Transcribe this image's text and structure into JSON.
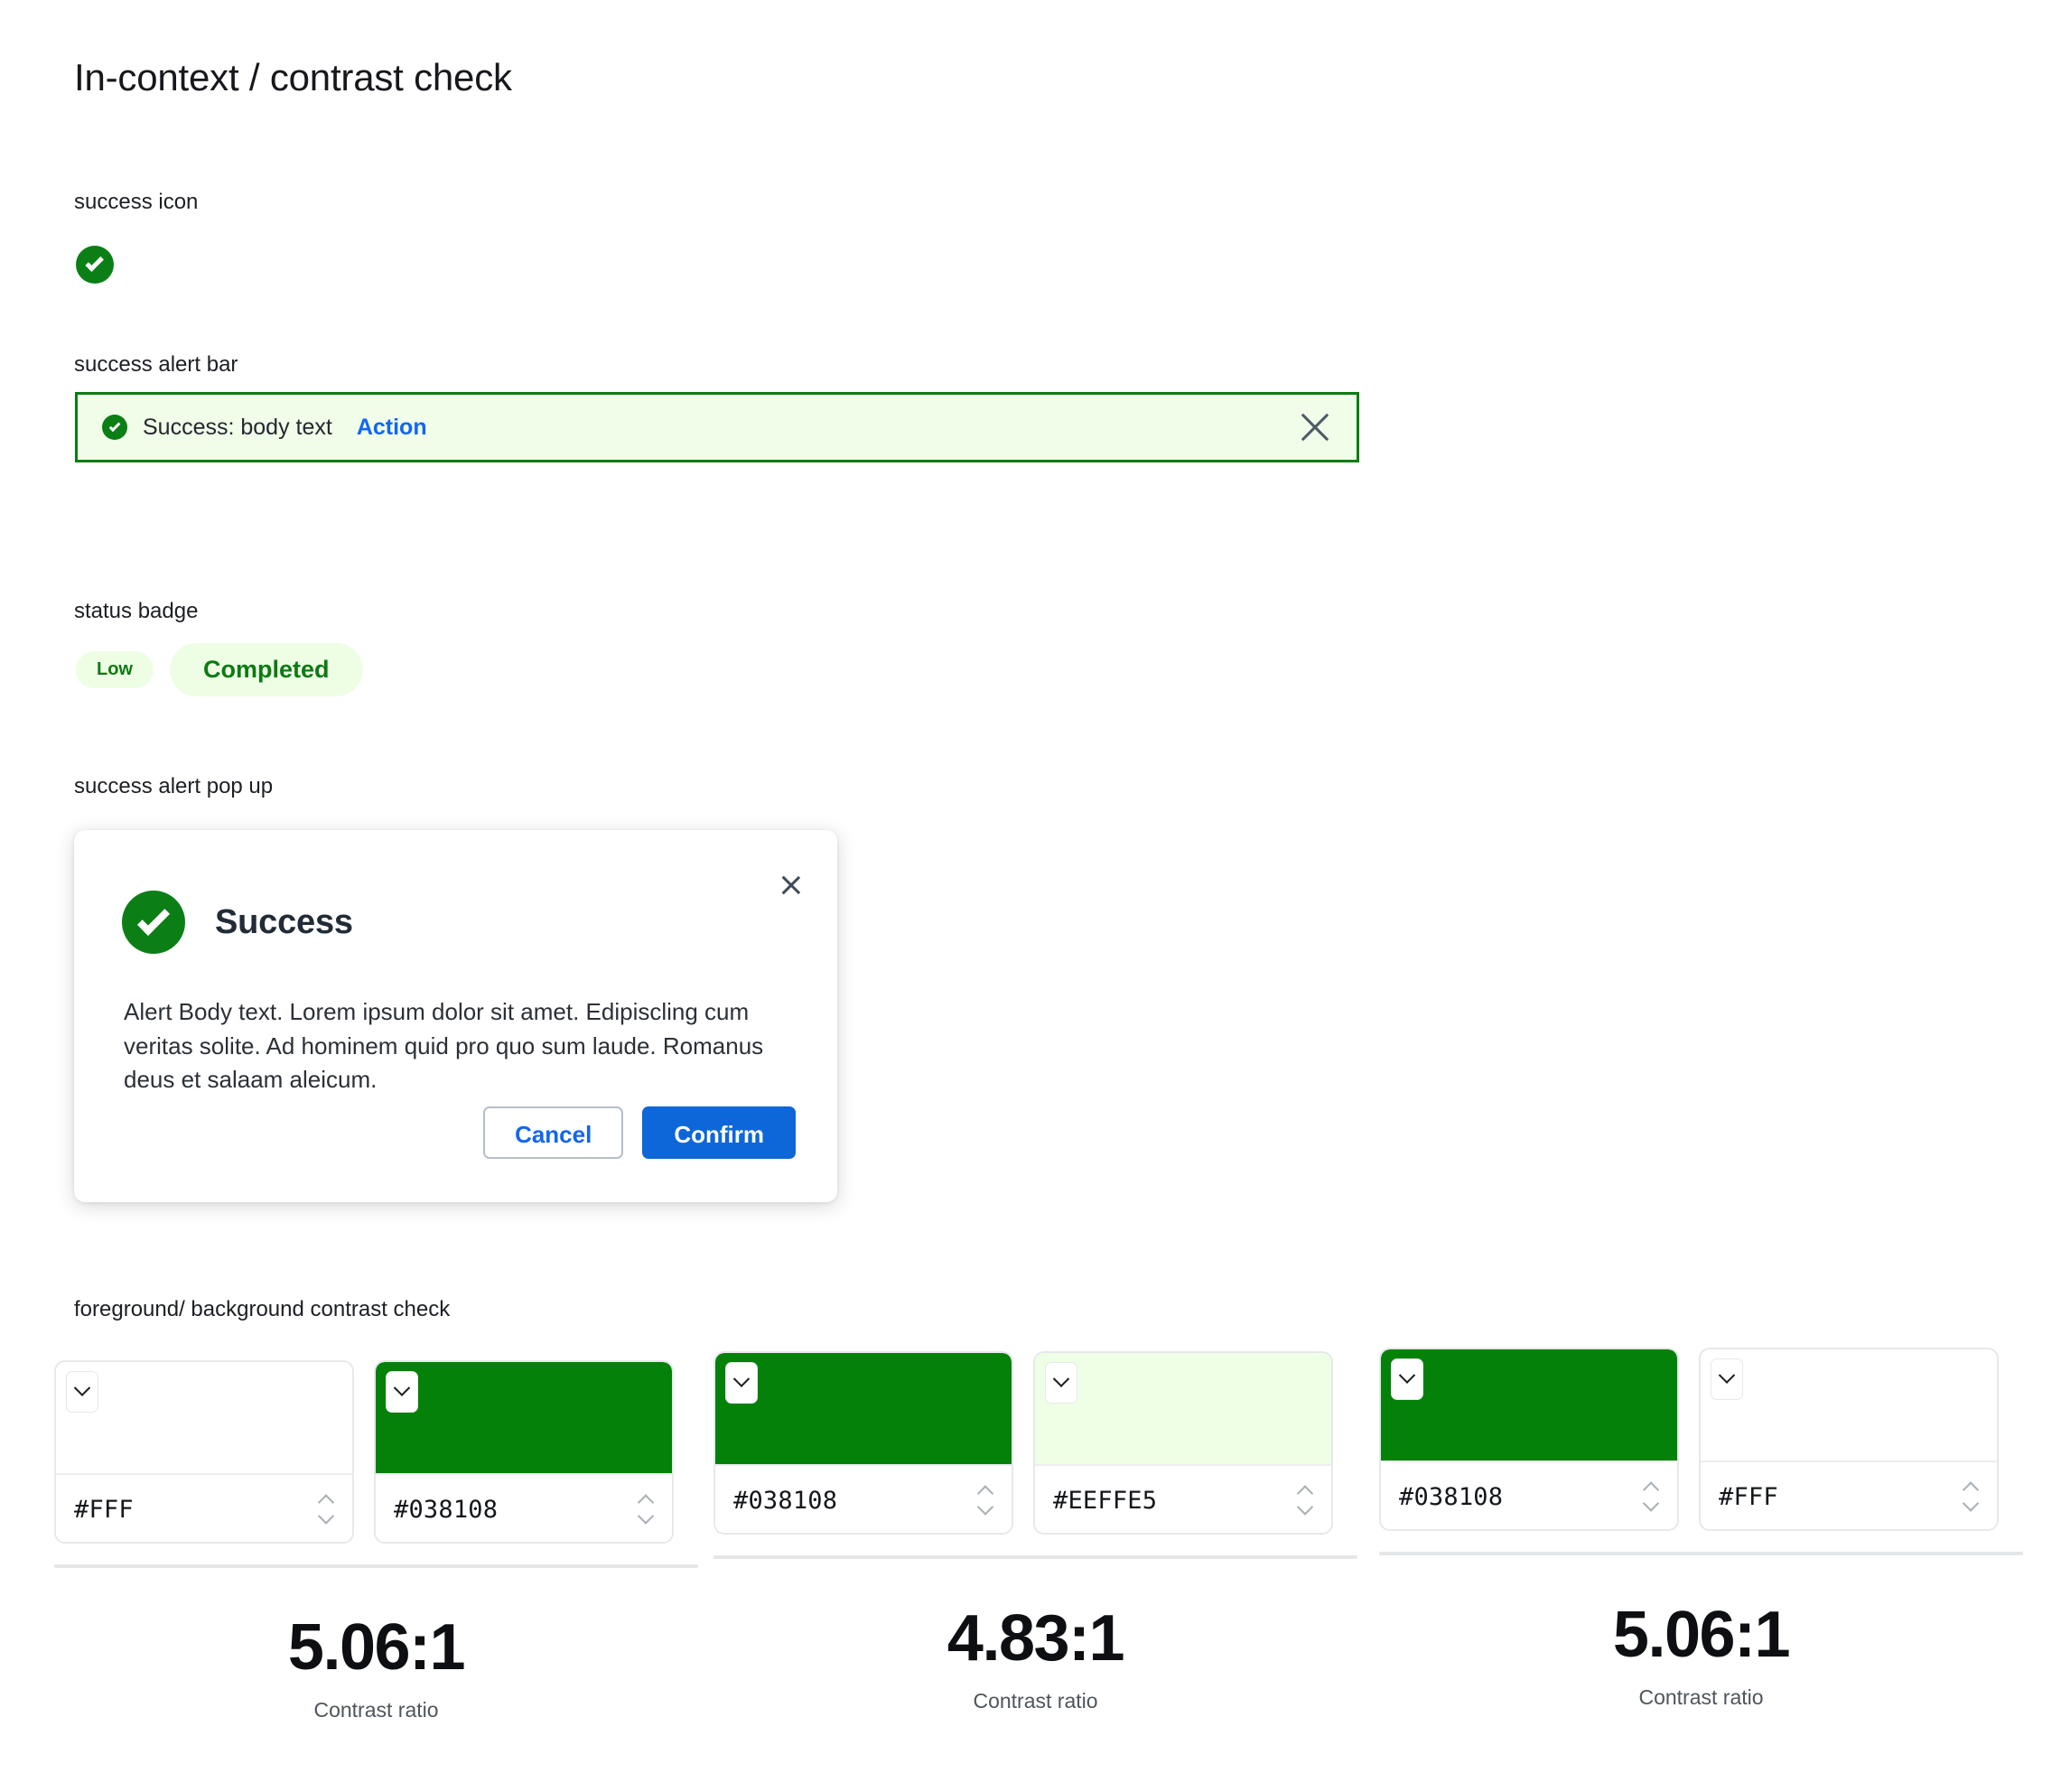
{
  "page": {
    "title": "In-context / contrast check"
  },
  "sections": {
    "success_icon": {
      "label": "success icon",
      "icon": "check-circle-icon",
      "color": "#0B7F16"
    },
    "alert_bar": {
      "label": "success alert bar",
      "icon": "check-circle-icon",
      "message": "Success: body text",
      "action_label": "Action",
      "close_icon": "close-icon",
      "background": "#EFFDE9",
      "border_color": "#0A7D12",
      "action_color": "#1266EF"
    },
    "status_badge": {
      "label": "status badge",
      "badges": [
        {
          "text": "Low",
          "size": "small"
        },
        {
          "text": "Completed",
          "size": "large"
        }
      ],
      "background": "#EEFEE5",
      "text_color": "#0D7A13"
    },
    "alert_popup": {
      "label": "success alert pop up",
      "icon": "check-circle-icon",
      "title": "Success",
      "body": "Alert Body text. Lorem ipsum dolor sit amet. Edipiscling cum veritas solite. Ad hominem quid pro quo sum laude. Romanus deus et salaam aleicum.",
      "close_icon": "close-icon",
      "cancel_label": "Cancel",
      "confirm_label": "Confirm",
      "confirm_color": "#0D67D8",
      "cancel_text_color": "#1266EF"
    },
    "contrast_check": {
      "label": "foreground/ background contrast check",
      "ratio_caption": "Contrast ratio",
      "groups": [
        {
          "swatches": [
            {
              "hex": "#FFF",
              "color": "#FFFFFF"
            },
            {
              "hex": "#038108",
              "color": "#038108"
            }
          ],
          "ratio": "5.06:1"
        },
        {
          "swatches": [
            {
              "hex": "#038108",
              "color": "#038108"
            },
            {
              "hex": "#EEFFE5",
              "color": "#EEFFE5"
            }
          ],
          "ratio": "4.83:1"
        },
        {
          "swatches": [
            {
              "hex": "#038108",
              "color": "#038108"
            },
            {
              "hex": "#FFF",
              "color": "#FFFFFF"
            }
          ],
          "ratio": "5.06:1"
        }
      ]
    }
  }
}
